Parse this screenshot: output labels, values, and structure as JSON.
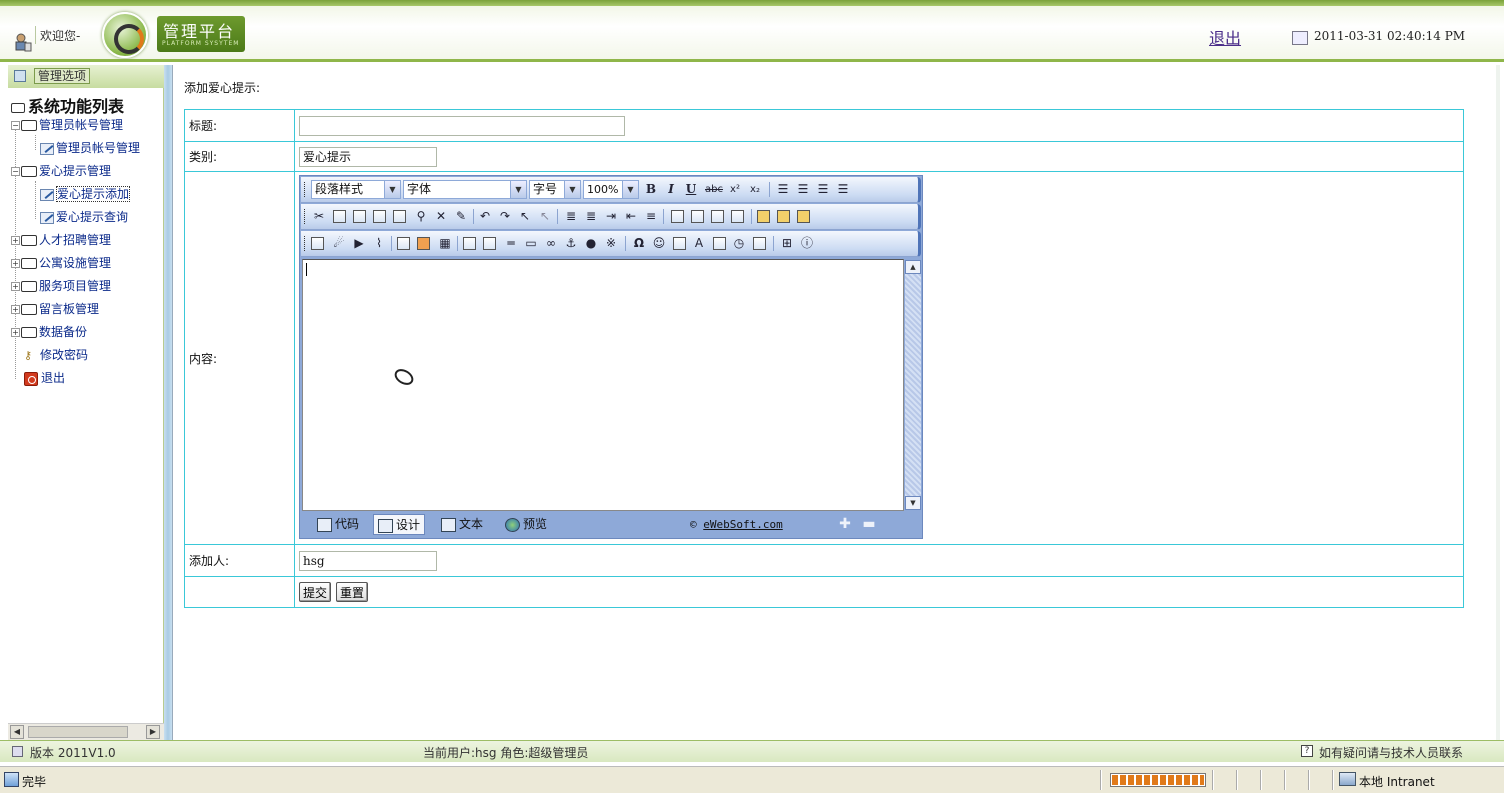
{
  "header": {
    "welcome": "欢迎您-",
    "logo_title": "管理平台",
    "logo_subtitle": "PLATFORM SYSYTEM",
    "logout": "退出",
    "datetime": "2011-03-31 02:40:14 PM"
  },
  "sidebar": {
    "header_label": "管理选项",
    "root_label": "系统功能列表",
    "items": [
      {
        "label": "管理员帐号管理",
        "type": "folder",
        "expanded": true
      },
      {
        "label": "管理员帐号管理",
        "type": "page"
      },
      {
        "label": "爱心提示管理",
        "type": "folder",
        "expanded": true
      },
      {
        "label": "爱心提示添加",
        "type": "page",
        "selected": true
      },
      {
        "label": "爱心提示查询",
        "type": "page"
      },
      {
        "label": "人才招聘管理",
        "type": "folder",
        "expanded": false
      },
      {
        "label": "公寓设施管理",
        "type": "folder",
        "expanded": false
      },
      {
        "label": "服务项目管理",
        "type": "folder",
        "expanded": false
      },
      {
        "label": "留言板管理",
        "type": "folder",
        "expanded": false
      },
      {
        "label": "数据备份",
        "type": "folder",
        "expanded": false
      },
      {
        "label": "修改密码",
        "type": "key"
      },
      {
        "label": "退出",
        "type": "exit"
      }
    ],
    "scroll_thumb": "III"
  },
  "main": {
    "title": "添加爱心提示:",
    "form": {
      "title_label": "标题:",
      "title_value": "",
      "category_label": "类别:",
      "category_value": "爱心提示",
      "content_label": "内容:",
      "adder_label": "添加人:",
      "adder_value": "hsg",
      "submit_label": "提交",
      "reset_label": "重置"
    },
    "editor": {
      "paragraph_style": "段落样式",
      "font": "字体",
      "font_size": "字号",
      "zoom": "100%",
      "bold": "B",
      "italic": "I",
      "underline": "U",
      "strike": "abc",
      "superscript": "x²",
      "subscript": "x₂",
      "modes": [
        "代码",
        "设计",
        "文本",
        "预览"
      ],
      "active_mode": "设计",
      "copyright_symbol": "©",
      "copyright_link": "eWebSoft.com"
    }
  },
  "footer": {
    "version": "版本 2011V1.0",
    "current_user": "当前用户:hsg  角色:超级管理员",
    "help": "如有疑问请与技术人员联系"
  },
  "statusbar": {
    "done": "完毕",
    "zone": "本地 Intranet"
  }
}
